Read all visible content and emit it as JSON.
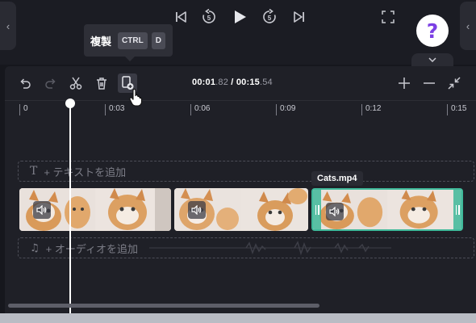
{
  "player": {
    "controls": [
      "skip-back-icon",
      "rewind-5-icon",
      "play-icon",
      "forward-5-icon",
      "skip-forward-icon",
      "fullscreen-icon"
    ],
    "rewind_label": "5",
    "forward_label": "5",
    "help_label": "?"
  },
  "tooltip": {
    "label": "複製",
    "key1": "CTRL",
    "key2": "D"
  },
  "toolbar": {
    "buttons": [
      "undo-icon",
      "redo-icon",
      "split-icon",
      "delete-icon",
      "duplicate-icon"
    ],
    "timecode": {
      "current_main": "00:01",
      "current_frac": ".82",
      "separator": " / ",
      "total_main": "00:15",
      "total_frac": ".54"
    },
    "zoom": [
      "zoom-in-icon",
      "zoom-out-icon",
      "fit-icon"
    ]
  },
  "ruler": {
    "labels": [
      "0",
      "0:03",
      "0:06",
      "0:09",
      "0:12",
      "0:15"
    ]
  },
  "tracks": {
    "text_placeholder": "+ テキストを追加",
    "audio_placeholder": "+ オーディオを追加"
  },
  "clips": [
    {
      "name": "Cats.mp4",
      "selected": false
    },
    {
      "name": "Cats.mp4",
      "selected": false
    },
    {
      "name": "Cats.mp4",
      "selected": true
    }
  ],
  "selected_clip_label": "Cats.mp4",
  "colors": {
    "accent": "#3fb99a",
    "help": "#7b3fe4"
  }
}
